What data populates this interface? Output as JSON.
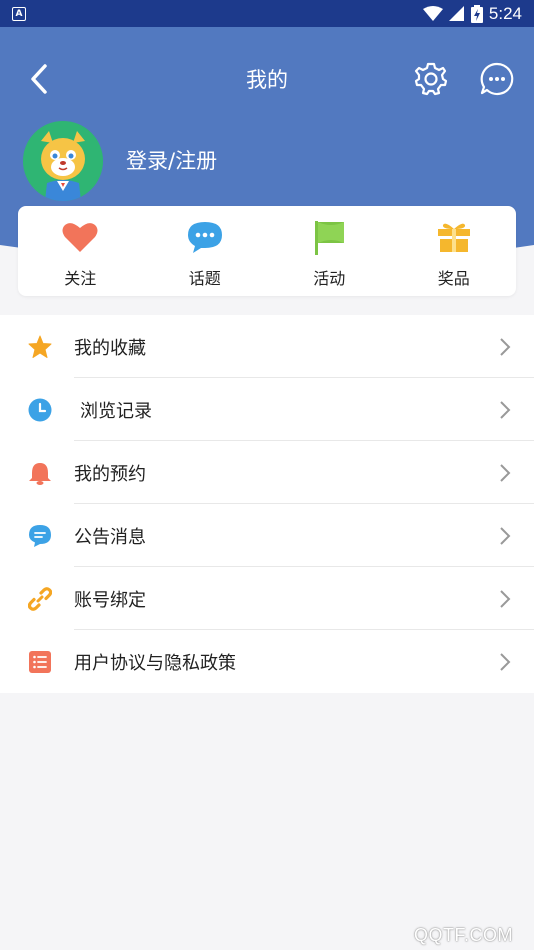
{
  "status_bar": {
    "app_badge": "A",
    "time": "5:24"
  },
  "header": {
    "title": "我的",
    "login_label": "登录/注册",
    "background_color": "#5279c0"
  },
  "quick_actions": [
    {
      "label": "关注",
      "icon": "heart-icon",
      "color": "#f2745a"
    },
    {
      "label": "话题",
      "icon": "chat-bubble-icon",
      "color": "#3ca2e6"
    },
    {
      "label": "活动",
      "icon": "flag-icon",
      "color": "#7cc444"
    },
    {
      "label": "奖品",
      "icon": "gift-icon",
      "color": "#f5b72d"
    }
  ],
  "menu": [
    {
      "label": "我的收藏",
      "icon": "star-icon",
      "color": "#f5a623"
    },
    {
      "label": "浏览记录",
      "icon": "clock-icon",
      "color": "#3ca2e6"
    },
    {
      "label": "我的预约",
      "icon": "bell-icon",
      "color": "#f2745a"
    },
    {
      "label": "公告消息",
      "icon": "message-icon",
      "color": "#3ca2e6"
    },
    {
      "label": "账号绑定",
      "icon": "link-icon",
      "color": "#f5a623"
    },
    {
      "label": "用户协议与隐私政策",
      "icon": "document-list-icon",
      "color": "#f2745a"
    }
  ],
  "watermark": "QQTF.COM"
}
